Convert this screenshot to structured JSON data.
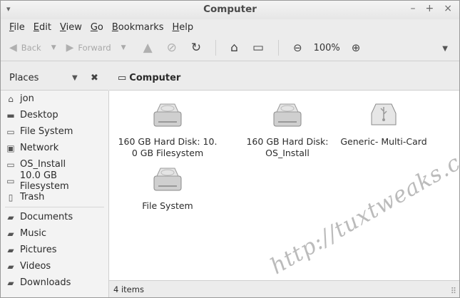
{
  "window": {
    "title": "Computer",
    "controls": [
      "–",
      "+",
      "×"
    ],
    "menu_glyph": "▾"
  },
  "menubar": [
    {
      "ul": "F",
      "rest": "ile"
    },
    {
      "ul": "E",
      "rest": "dit"
    },
    {
      "ul": "V",
      "rest": "iew"
    },
    {
      "ul": "G",
      "rest": "o"
    },
    {
      "ul": "B",
      "rest": "ookmarks"
    },
    {
      "ul": "H",
      "rest": "elp"
    }
  ],
  "toolbar": {
    "back": "Back",
    "forward": "Forward",
    "zoom": "100%"
  },
  "places": {
    "header": "Places",
    "items": [
      {
        "label": "jon",
        "icon": "home-icon"
      },
      {
        "label": "Desktop",
        "icon": "desktop-icon"
      },
      {
        "label": "File System",
        "icon": "drive-icon"
      },
      {
        "label": "Network",
        "icon": "network-icon"
      },
      {
        "label": "OS_Install",
        "icon": "drive-icon"
      },
      {
        "label": "10.0 GB Filesystem",
        "icon": "drive-icon"
      },
      {
        "label": "Trash",
        "icon": "trash-icon"
      }
    ],
    "bookmarks": [
      {
        "label": "Documents",
        "icon": "folder-icon"
      },
      {
        "label": "Music",
        "icon": "folder-icon"
      },
      {
        "label": "Pictures",
        "icon": "folder-icon"
      },
      {
        "label": "Videos",
        "icon": "folder-icon"
      },
      {
        "label": "Downloads",
        "icon": "folder-icon"
      }
    ]
  },
  "location": {
    "title": "Computer"
  },
  "files": [
    {
      "name": "160 GB Hard Disk: 10.\n0 GB Filesystem",
      "icon": "hard-disk-icon"
    },
    {
      "name": "160 GB Hard Disk:\nOS_Install",
      "icon": "hard-disk-icon"
    },
    {
      "name": "Generic- Multi-Card",
      "icon": "usb-drive-icon"
    },
    {
      "name": "File System",
      "icon": "hard-disk-icon"
    }
  ],
  "status": {
    "text": "4 items"
  },
  "watermark": "http://tuxtweaks.com/",
  "colors": {
    "sidebar_bg": "#f3f3f3",
    "content_bg": "#ffffff",
    "chrome_bg": "#ececec"
  }
}
